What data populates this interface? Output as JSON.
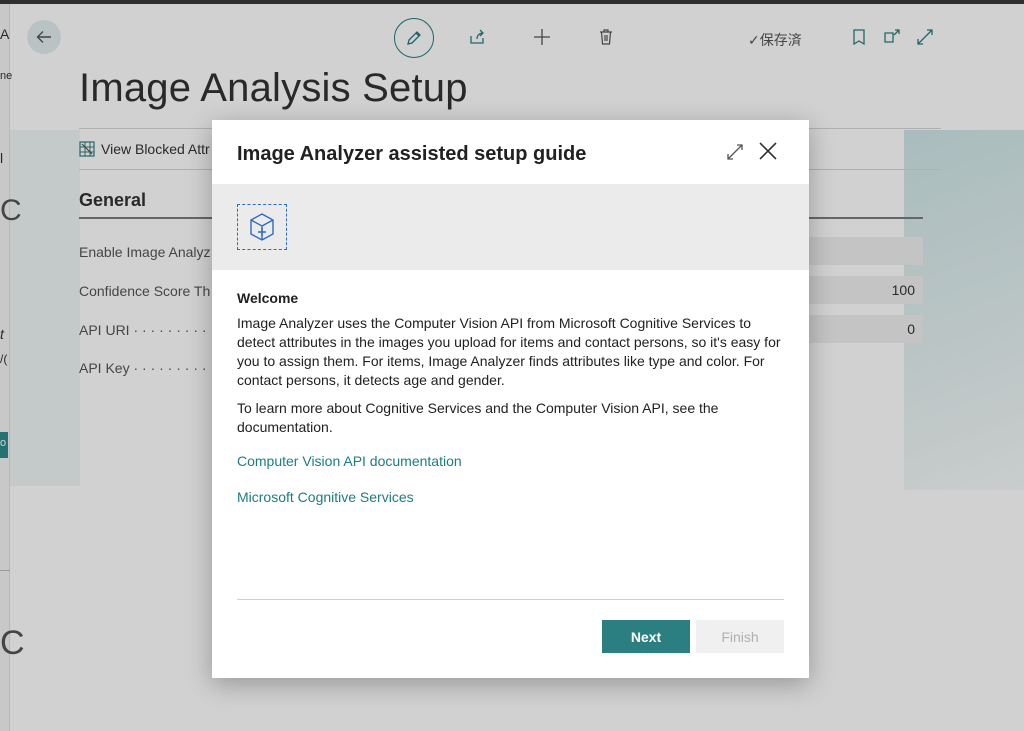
{
  "page": {
    "title": "Image Analysis Setup",
    "saved_status": "✓保存済",
    "left_edge_fragments": [
      "A",
      "ne",
      "l",
      "C",
      "t",
      "/(",
      "o",
      "C"
    ],
    "actions": {
      "view_blocked_label": "View Blocked Attr"
    },
    "general": {
      "heading": "General",
      "fields": [
        {
          "label": "Enable Image Analyz",
          "value": ""
        },
        {
          "label": "Confidence Score Th",
          "value": "100"
        },
        {
          "label": "API URI · · · · · · · · ·",
          "value": "0"
        },
        {
          "label": "API Key · · · · · · · · ·",
          "value": ""
        }
      ]
    }
  },
  "dialog": {
    "title": "Image Analyzer assisted setup guide",
    "welcome_title": "Welcome",
    "paragraph1": "Image Analyzer uses the Computer Vision API from Microsoft Cognitive Services to detect attributes in the images you upload for items and contact persons, so it's easy for you to assign them. For items, Image Analyzer finds attributes like type and color. For contact persons, it detects age and gender.",
    "paragraph2": "To learn more about Cognitive Services and the Computer Vision API, see the documentation.",
    "links": [
      "Computer Vision API documentation",
      "Microsoft Cognitive Services"
    ],
    "next_label": "Next",
    "finish_label": "Finish"
  },
  "colors": {
    "accent": "#2b7f80",
    "link": "#1c7c80",
    "banner_icon": "#2b6cbf"
  },
  "icons": [
    "back-arrow-icon",
    "edit-pencil-icon",
    "share-icon",
    "add-icon",
    "delete-icon",
    "bookmark-icon",
    "open-new-window-icon",
    "expand-icon",
    "close-icon",
    "cube-add-icon"
  ]
}
